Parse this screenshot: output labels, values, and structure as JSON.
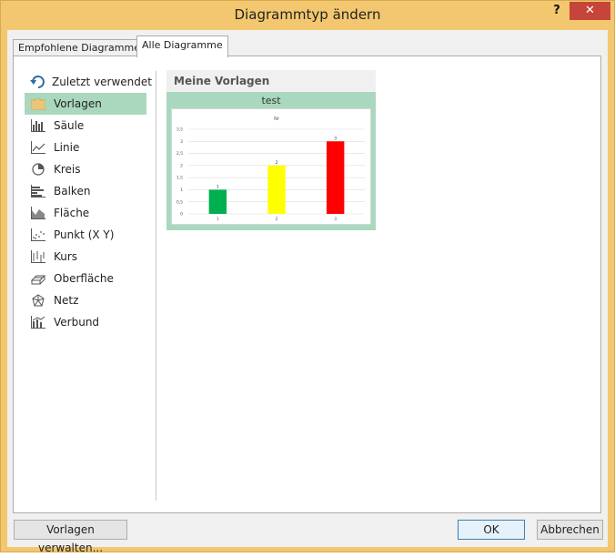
{
  "window": {
    "title": "Diagrammtyp ändern",
    "help_label": "?",
    "close_label": "✕"
  },
  "tabs": [
    {
      "label": "Empfohlene Diagramme",
      "active": false
    },
    {
      "label": "Alle Diagramme",
      "active": true
    }
  ],
  "categories": [
    {
      "label": "Zuletzt verwendet",
      "icon": "recent-icon"
    },
    {
      "label": "Vorlagen",
      "icon": "folder-icon",
      "selected": true
    },
    {
      "label": "Säule",
      "icon": "column-chart-icon"
    },
    {
      "label": "Linie",
      "icon": "line-chart-icon"
    },
    {
      "label": "Kreis",
      "icon": "pie-chart-icon"
    },
    {
      "label": "Balken",
      "icon": "bar-chart-icon"
    },
    {
      "label": "Fläche",
      "icon": "area-chart-icon"
    },
    {
      "label": "Punkt (X Y)",
      "icon": "scatter-chart-icon"
    },
    {
      "label": "Kurs",
      "icon": "stock-chart-icon"
    },
    {
      "label": "Oberfläche",
      "icon": "surface-chart-icon"
    },
    {
      "label": "Netz",
      "icon": "radar-chart-icon"
    },
    {
      "label": "Verbund",
      "icon": "combo-chart-icon"
    }
  ],
  "templates": {
    "section_title": "Meine Vorlagen",
    "items": [
      {
        "name": "test"
      }
    ]
  },
  "chart_data": {
    "type": "bar",
    "title": "Nr",
    "categories": [
      "1",
      "2",
      "3"
    ],
    "values": [
      1,
      2,
      3
    ],
    "data_labels": [
      "1",
      "2",
      "3"
    ],
    "colors": [
      "#00b050",
      "#ffff00",
      "#ff0000"
    ],
    "ylim": [
      0,
      3.5
    ],
    "yticks": [
      "0",
      "0,5",
      "1",
      "1,5",
      "2",
      "2,5",
      "3",
      "3,5"
    ],
    "grid": true
  },
  "footer": {
    "manage_label": "Vorlagen verwalten...",
    "ok_label": "OK",
    "cancel_label": "Abbrechen"
  },
  "colors": {
    "frame": "#f3c76f",
    "close": "#c7443a",
    "selection": "#a9d8bf"
  }
}
